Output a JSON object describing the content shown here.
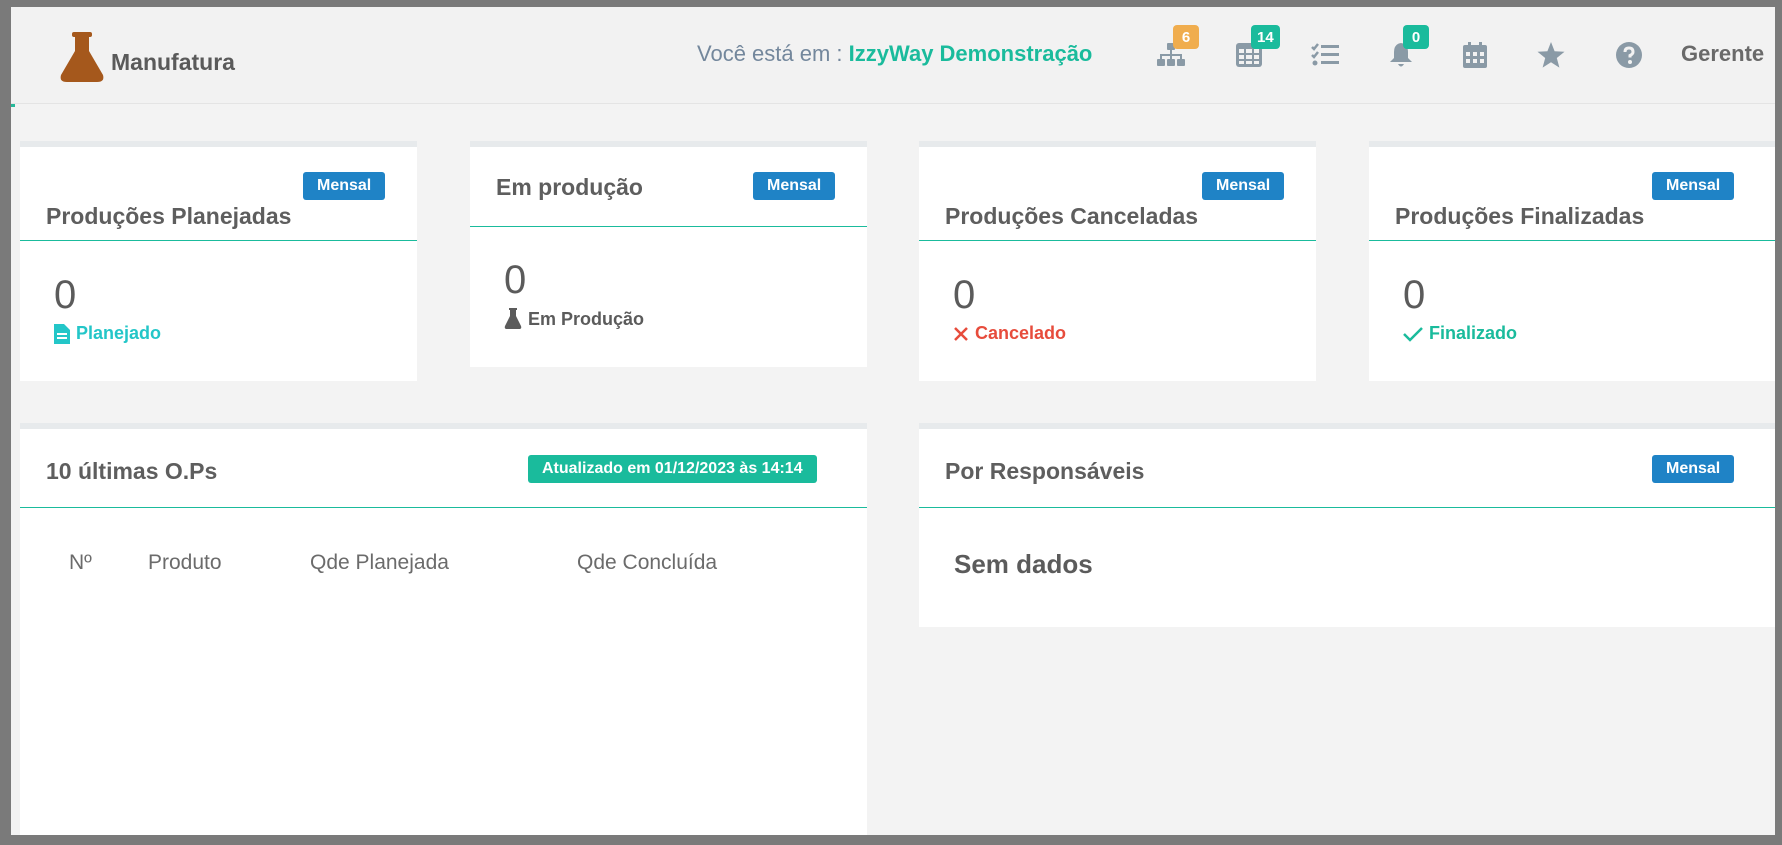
{
  "header": {
    "brand": "Manufatura",
    "location_prefix": "Você está em :",
    "company": "IzzyWay Demonstração",
    "user": "Gerente",
    "nav": [
      {
        "icon": "sitemap-icon",
        "badge": "6",
        "badge_color": "#f0ad4e"
      },
      {
        "icon": "table-icon",
        "badge": "14",
        "badge_color": "#1abb9c"
      },
      {
        "icon": "tasks-icon",
        "badge": "",
        "badge_color": ""
      },
      {
        "icon": "bell-icon",
        "badge": "0",
        "badge_color": "#1abb9c"
      },
      {
        "icon": "calendar-icon",
        "badge": "",
        "badge_color": ""
      },
      {
        "icon": "star-icon",
        "badge": "",
        "badge_color": ""
      },
      {
        "icon": "help-icon",
        "badge": "",
        "badge_color": ""
      }
    ]
  },
  "stats": [
    {
      "title": "Produções Planejadas",
      "period": "Mensal",
      "value": "0",
      "label": "Planejado",
      "icon": "file-icon",
      "color": "#23c6c8"
    },
    {
      "title": "Em produção",
      "period": "Mensal",
      "value": "0",
      "label": "Em Produção",
      "icon": "flask-icon",
      "color": "#5b5b5b"
    },
    {
      "title": "Produções Canceladas",
      "period": "Mensal",
      "value": "0",
      "label": "Cancelado",
      "icon": "times-icon",
      "color": "#e74c3c"
    },
    {
      "title": "Produções Finalizadas",
      "period": "Mensal",
      "value": "0",
      "label": "Finalizado",
      "icon": "check-icon",
      "color": "#1abb9c"
    }
  ],
  "latest_orders": {
    "title": "10 últimas O.Ps",
    "updated": "Atualizado em 01/12/2023 às 14:14",
    "columns": [
      "Nº",
      "Produto",
      "Qde Planejada",
      "Qde Concluída"
    ]
  },
  "responsibles": {
    "title": "Por Responsáveis",
    "period": "Mensal",
    "empty": "Sem dados"
  },
  "colors": {
    "accent": "#1abb9c",
    "label_blue": "#1f83c6",
    "brand_icon": "#a5581c",
    "nav_icon": "#8a9aa6"
  }
}
